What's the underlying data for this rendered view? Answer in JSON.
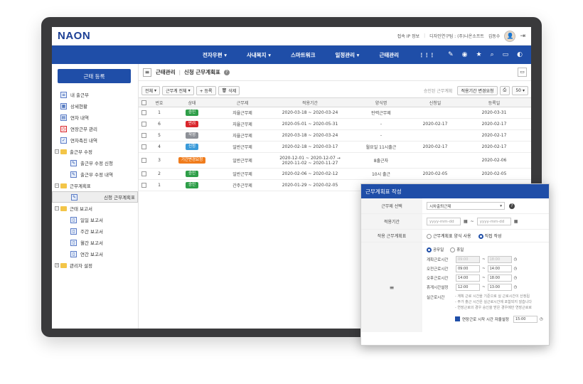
{
  "header": {
    "logo": "NAON",
    "ip_info": "접속 IP 정보",
    "dept": "디자인연구팀 : (주)나온소프트",
    "user": "김동수"
  },
  "nav": {
    "items": [
      "전자우편 ▾",
      "사내복지 ▾",
      "스마트워크",
      "일정관리 ▾",
      "근태관리",
      "⋮⋮⋮"
    ]
  },
  "sidebar": {
    "register_button": "근태 등록",
    "items": [
      {
        "label": "내 출근부",
        "icon": "document-icon"
      },
      {
        "label": "상세현황",
        "icon": "chart-icon"
      },
      {
        "label": "연차 내역",
        "icon": "calendar-icon"
      },
      {
        "label": "연장근무 관리",
        "icon": "clock-icon"
      },
      {
        "label": "연차촉진 내역",
        "icon": "check-icon"
      },
      {
        "label": "출근부 수정",
        "icon": "folder-icon"
      },
      {
        "label": "출근부 수정 신청",
        "icon": "edit-icon"
      },
      {
        "label": "출근부 수정 내역",
        "icon": "edit-icon"
      },
      {
        "label": "근무계획표",
        "icon": "folder-icon"
      },
      {
        "label": "신청 근무계획표",
        "icon": "edit-icon"
      },
      {
        "label": "근태 보고서",
        "icon": "folder-icon"
      },
      {
        "label": "일일 보고서",
        "icon": "page-icon"
      },
      {
        "label": "주간 보고서",
        "icon": "page-icon"
      },
      {
        "label": "월간 보고서",
        "icon": "page-icon"
      },
      {
        "label": "연간 보고서",
        "icon": "page-icon"
      },
      {
        "label": "관리자 설정",
        "icon": "folder-gear-icon"
      }
    ]
  },
  "breadcrumb": {
    "parent": "근태관리",
    "current": "신청 근무계획표"
  },
  "toolbar": {
    "filter_all": "전체",
    "filter_type": "근무계 전체",
    "add": "+ 등록",
    "delete": "삭제",
    "approved_label": "승인된 근무계획",
    "change_request": "적용기간 변경요청",
    "page_size": "50"
  },
  "table": {
    "headers": [
      "",
      "번호",
      "상태",
      "근무제",
      "적용기간",
      "양식명",
      "신청일",
      "등록일"
    ],
    "rows": [
      {
        "no": "1",
        "status": "승인",
        "color": "#2e9e48",
        "type": "자율근무제",
        "period": "2020-03-18 ~ 2020-03-24",
        "form": "탄력근무제",
        "applied": "",
        "registered": "2020-03-31"
      },
      {
        "no": "6",
        "status": "반려",
        "color": "#d9262c",
        "type": "자율근무제",
        "period": "2020-05-01 ~ 2020-05-31",
        "form": "-",
        "applied": "2020-02-17",
        "registered": "2020-02-17"
      },
      {
        "no": "5",
        "status": "작성",
        "color": "#8d9097",
        "type": "자율근무제",
        "period": "2020-03-18 ~ 2020-03-24",
        "form": "-",
        "applied": "",
        "registered": "2020-02-17"
      },
      {
        "no": "4",
        "status": "신청",
        "color": "#3a9ad9",
        "type": "일반근무제",
        "period": "2020-02-18 ~ 2020-03-17",
        "form": "월요일 11시출근",
        "applied": "2020-02-17",
        "registered": "2020-02-17"
      },
      {
        "no": "3",
        "status": "기간변경요청",
        "color": "#f07c1c",
        "type": "일반근무제",
        "period": "2020-12-01 ~ 2020-12-07 → 2020-11-02 ~ 2020-11-27",
        "form": "8출근자",
        "applied": "",
        "registered": "2020-02-06"
      },
      {
        "no": "2",
        "status": "승인",
        "color": "#2e9e48",
        "type": "일반근무제",
        "period": "2020-02-06 ~ 2020-02-12",
        "form": "10시 출근",
        "applied": "2020-02-05",
        "registered": "2020-02-05"
      },
      {
        "no": "1",
        "status": "승인",
        "color": "#2e9e48",
        "type": "간주근무제",
        "period": "2020-01-29 ~ 2020-02-05",
        "form": "",
        "applied": "",
        "registered": ""
      }
    ]
  },
  "dialog": {
    "title": "근무계획표 작성",
    "type_label": "근무제 선택",
    "type_value": "시차출퇴근제",
    "period_label": "적용기간",
    "date_placeholder": "yyyy-mm-dd",
    "plan_label": "작용 근무계획표",
    "plan_opt1": "근무계획표 양식 사용",
    "plan_opt2": "직접 작성",
    "day_opt1": "공무일",
    "day_opt2": "휴일",
    "left_mark": "≡",
    "times": [
      {
        "label": "계획근로시간",
        "from": "09:00",
        "to": "18:00",
        "disabled": true
      },
      {
        "label": "오전근로시간",
        "from": "09:00",
        "to": "14:00",
        "disabled": false
      },
      {
        "label": "오후근로시간",
        "from": "14:00",
        "to": "18:00",
        "disabled": false
      },
      {
        "label": "휴게시간설정",
        "from": "12:00",
        "to": "13:00",
        "disabled": false
      }
    ],
    "actual_label": "실근로시간",
    "notes": [
      "- 계획 근로 시간을 기준으로 실 근로시간이 산정됩",
      "- 주가 출근 시간은 실근로시간에 포함되지 않습니다",
      "- 연장근로의 경우 승인을 받은 경우에만 연장근로로"
    ],
    "overtime_label": "연장근로 시작 시간 자율설정",
    "overtime_value": "15:00"
  }
}
